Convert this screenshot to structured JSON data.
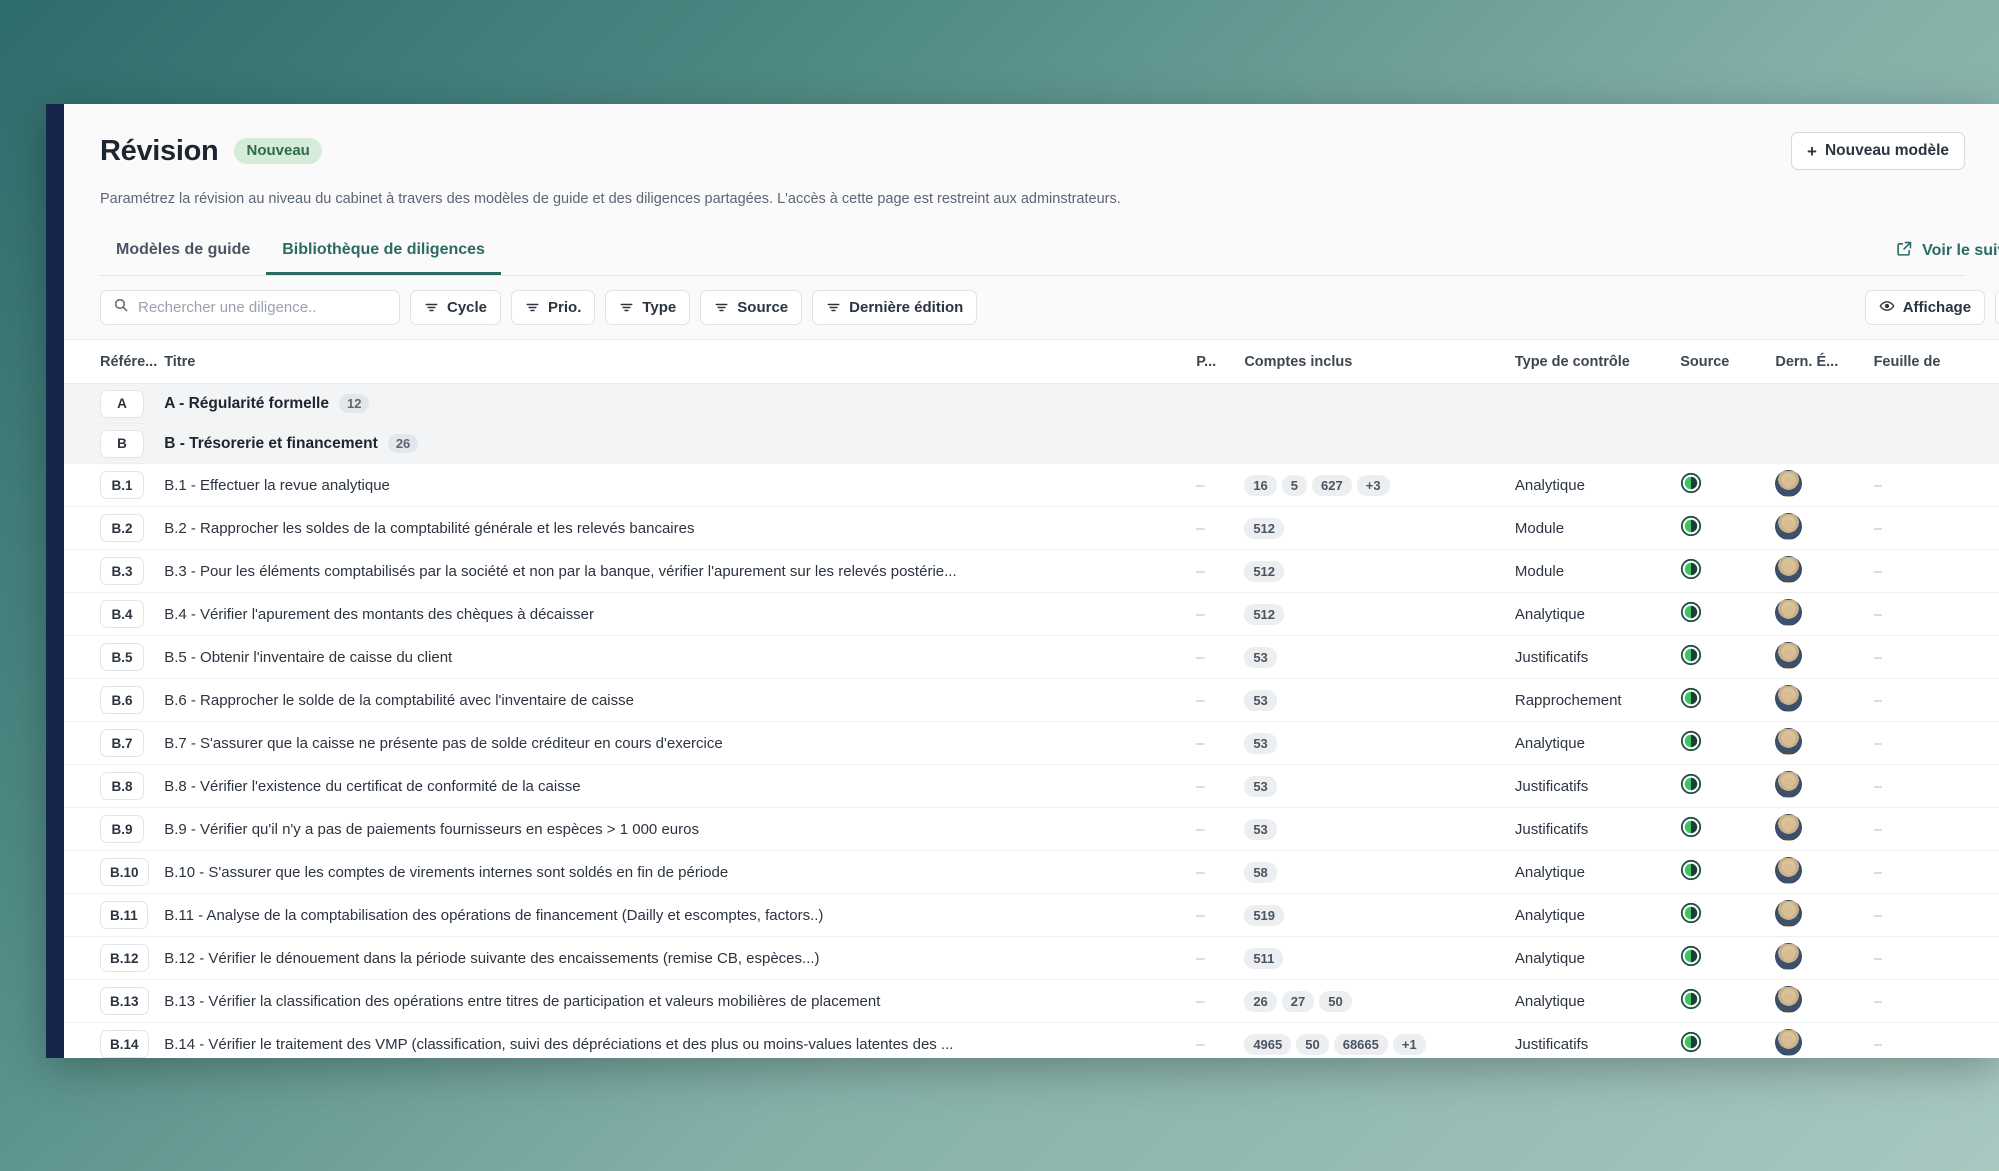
{
  "header": {
    "title": "Révision",
    "badge": "Nouveau",
    "new_template_button": "+ Nouveau modèle",
    "new_template_label": "Nouveau modèle",
    "subtitle": "Paramétrez la révision au niveau du cabinet à travers des modèles de guide et des diligences partagées. L'accès à cette page est restreint aux adminstrateurs."
  },
  "tabs": [
    {
      "label": "Modèles de guide",
      "active": false
    },
    {
      "label": "Bibliothèque de diligences",
      "active": true
    }
  ],
  "tracking_link": {
    "label": "Voir le suivi d",
    "icon": "external-link-icon"
  },
  "toolbar": {
    "search": {
      "placeholder": "Rechercher une diligence..",
      "value": "",
      "icon": "search-icon"
    },
    "filters": [
      {
        "label": "Cycle",
        "icon": "filter-icon"
      },
      {
        "label": "Prio.",
        "icon": "filter-icon"
      },
      {
        "label": "Type",
        "icon": "filter-icon"
      },
      {
        "label": "Source",
        "icon": "filter-icon"
      },
      {
        "label": "Dernière édition",
        "icon": "filter-icon"
      }
    ],
    "display_button": {
      "label": "Affichage",
      "icon": "eye-icon"
    },
    "add_button": {
      "label": "+",
      "icon": "plus-icon"
    }
  },
  "table": {
    "columns": [
      "Référe...",
      "Titre",
      "P...",
      "Comptes inclus",
      "Type de contrôle",
      "Source",
      "Dern. É...",
      "Feuille de "
    ],
    "rows": [
      {
        "kind": "group",
        "ref": "A",
        "title": "A - Régularité formelle",
        "count": "12"
      },
      {
        "kind": "group",
        "ref": "B",
        "title": "B - Trésorerie et financement",
        "count": "26"
      },
      {
        "kind": "item",
        "ref": "B.1",
        "title": "B.1 - Effectuer la revue analytique",
        "prio": "–",
        "accounts": [
          "16",
          "5",
          "627",
          "+3"
        ],
        "control": "Analytique",
        "source": "half-circle-icon",
        "editor": "avatar",
        "sheet": "–"
      },
      {
        "kind": "item",
        "ref": "B.2",
        "title": "B.2 - Rapprocher les soldes de la comptabilité générale et les relevés bancaires",
        "prio": "–",
        "accounts": [
          "512"
        ],
        "control": "Module",
        "source": "half-circle-icon",
        "editor": "avatar",
        "sheet": "–"
      },
      {
        "kind": "item",
        "ref": "B.3",
        "title": "B.3 - Pour les éléments comptabilisés par la société et non par la banque, vérifier l'apurement sur les relevés postérie...",
        "prio": "–",
        "accounts": [
          "512"
        ],
        "control": "Module",
        "source": "half-circle-icon",
        "editor": "avatar",
        "sheet": "–"
      },
      {
        "kind": "item",
        "ref": "B.4",
        "title": "B.4 - Vérifier l'apurement des montants des chèques à décaisser",
        "prio": "–",
        "accounts": [
          "512"
        ],
        "control": "Analytique",
        "source": "half-circle-icon",
        "editor": "avatar",
        "sheet": "–"
      },
      {
        "kind": "item",
        "ref": "B.5",
        "title": "B.5 - Obtenir l'inventaire de caisse du client",
        "prio": "–",
        "accounts": [
          "53"
        ],
        "control": "Justificatifs",
        "source": "half-circle-icon",
        "editor": "avatar",
        "sheet": "–"
      },
      {
        "kind": "item",
        "ref": "B.6",
        "title": "B.6 - Rapprocher le solde de la comptabilité avec l'inventaire de caisse",
        "prio": "–",
        "accounts": [
          "53"
        ],
        "control": "Rapprochement",
        "source": "half-circle-icon",
        "editor": "avatar",
        "sheet": "–"
      },
      {
        "kind": "item",
        "ref": "B.7",
        "title": "B.7 - S'assurer que la caisse ne présente pas de solde créditeur en cours d'exercice",
        "prio": "–",
        "accounts": [
          "53"
        ],
        "control": "Analytique",
        "source": "half-circle-icon",
        "editor": "avatar",
        "sheet": "–"
      },
      {
        "kind": "item",
        "ref": "B.8",
        "title": "B.8 - Vérifier l'existence du certificat de conformité de la caisse",
        "prio": "–",
        "accounts": [
          "53"
        ],
        "control": "Justificatifs",
        "source": "half-circle-icon",
        "editor": "avatar",
        "sheet": "–"
      },
      {
        "kind": "item",
        "ref": "B.9",
        "title": "B.9 - Vérifier qu'il n'y a pas de paiements fournisseurs en espèces > 1 000 euros",
        "prio": "–",
        "accounts": [
          "53"
        ],
        "control": "Justificatifs",
        "source": "half-circle-icon",
        "editor": "avatar",
        "sheet": "–"
      },
      {
        "kind": "item",
        "ref": "B.10",
        "title": "B.10 - S'assurer que les comptes de virements internes sont soldés en fin de période",
        "prio": "–",
        "accounts": [
          "58"
        ],
        "control": "Analytique",
        "source": "half-circle-icon",
        "editor": "avatar",
        "sheet": "–"
      },
      {
        "kind": "item",
        "ref": "B.11",
        "title": "B.11 - Analyse de la comptabilisation des opérations de financement (Dailly et escomptes, factors..)",
        "prio": "–",
        "accounts": [
          "519"
        ],
        "control": "Analytique",
        "source": "half-circle-icon",
        "editor": "avatar",
        "sheet": "–"
      },
      {
        "kind": "item",
        "ref": "B.12",
        "title": "B.12 - Vérifier le dénouement dans la période suivante des encaissements (remise CB, espèces...)",
        "prio": "–",
        "accounts": [
          "511"
        ],
        "control": "Analytique",
        "source": "half-circle-icon",
        "editor": "avatar",
        "sheet": "–"
      },
      {
        "kind": "item",
        "ref": "B.13",
        "title": "B.13 - Vérifier la classification des opérations entre titres de participation et valeurs mobilières de placement",
        "prio": "–",
        "accounts": [
          "26",
          "27",
          "50"
        ],
        "control": "Analytique",
        "source": "half-circle-icon",
        "editor": "avatar",
        "sheet": "–"
      },
      {
        "kind": "item",
        "ref": "B.14",
        "title": "B.14 - Vérifier le traitement des VMP (classification, suivi des dépréciations et des plus ou moins-values latentes des ...",
        "prio": "–",
        "accounts": [
          "4965",
          "50",
          "68665",
          "+1"
        ],
        "control": "Justificatifs",
        "source": "half-circle-icon",
        "editor": "avatar",
        "sheet": "–"
      }
    ]
  },
  "colors": {
    "accent": "#2c6b63",
    "badge_bg": "#d4ecd9",
    "badge_fg": "#2f6b48",
    "sidebar": "#16254b",
    "source_green": "#3fc463"
  }
}
